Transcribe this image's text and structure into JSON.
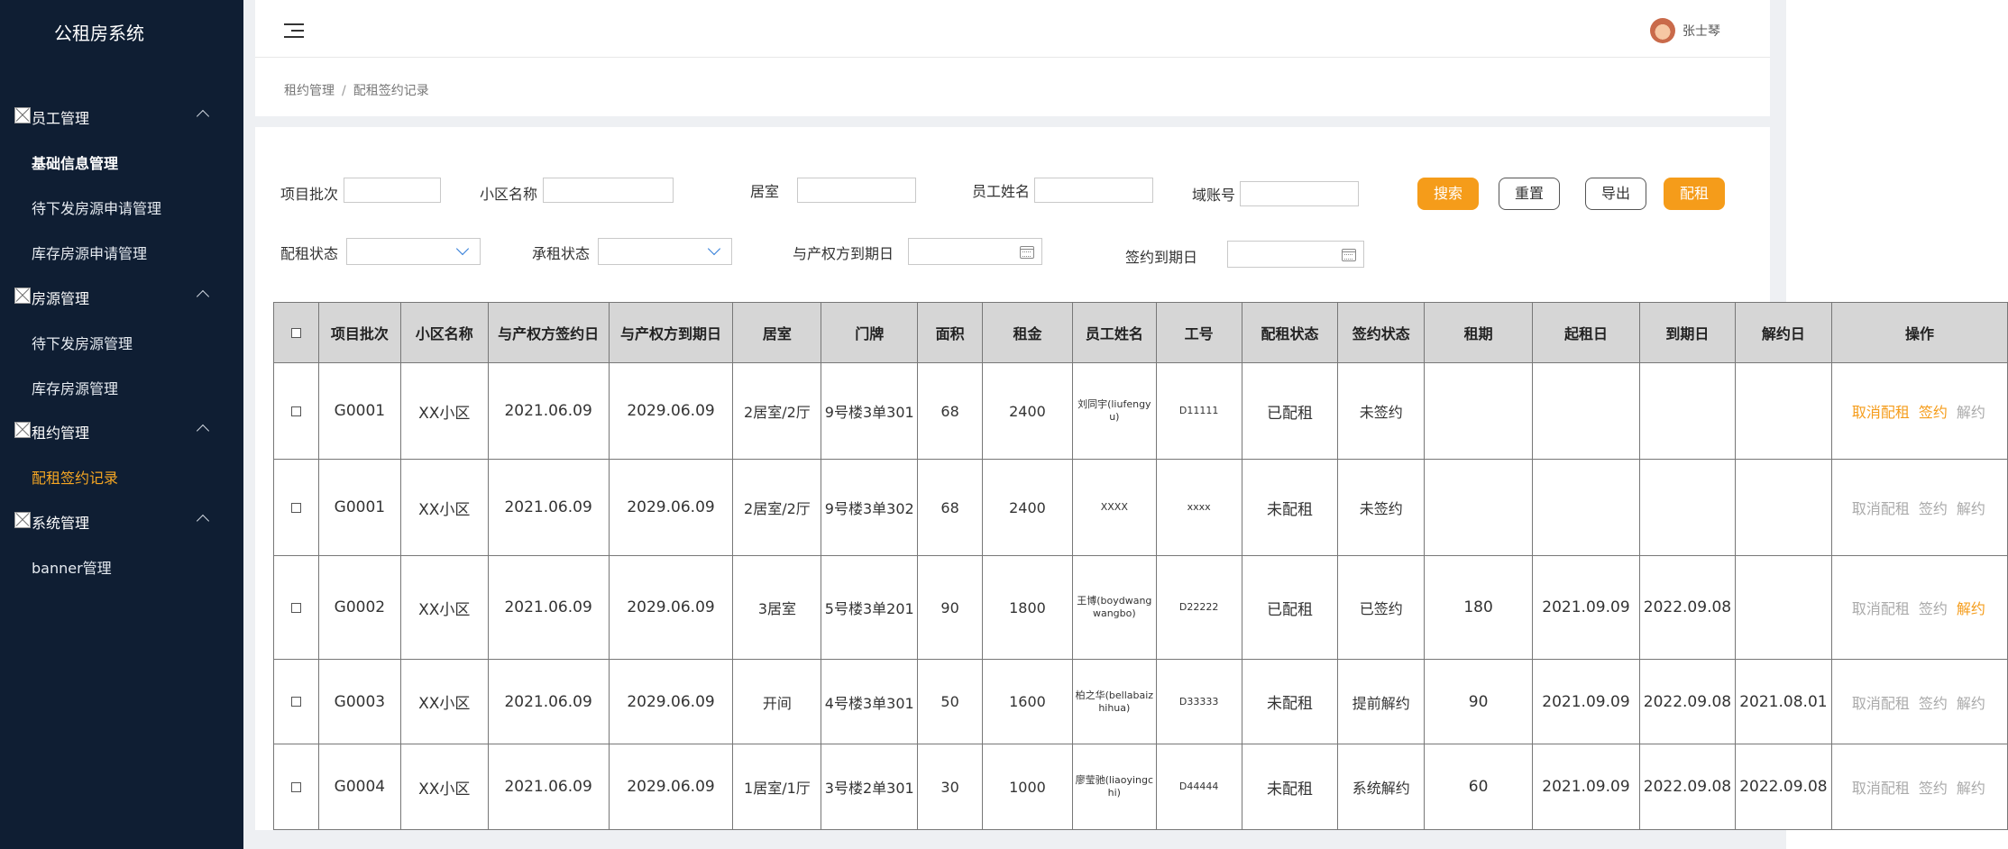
{
  "app": {
    "title": "公租房系统"
  },
  "sidebar": {
    "groups": [
      {
        "label": "员工管理",
        "items": [
          "基础信息管理",
          "待下发房源申请管理",
          "库存房源申请管理"
        ]
      },
      {
        "label": "房源管理",
        "items": [
          "待下发房源管理",
          "库存房源管理"
        ]
      },
      {
        "label": "租约管理",
        "items": [
          "配租签约记录"
        ]
      },
      {
        "label": "系统管理",
        "items": [
          "banner管理"
        ]
      }
    ]
  },
  "header": {
    "user_name": "张士琴"
  },
  "breadcrumb": {
    "parent": "租约管理",
    "sep": "/",
    "current": "配租签约记录"
  },
  "filters": {
    "batch_label": "项目批次",
    "community_label": "小区名称",
    "room_label": "居室",
    "staff_label": "员工姓名",
    "domain_label": "域账号",
    "alloc_status_label": "配租状态",
    "lease_status_label": "承租状态",
    "owner_expiry_label": "与产权方到期日",
    "sign_expiry_label": "签约到期日"
  },
  "buttons": {
    "search": "搜索",
    "reset": "重置",
    "export": "导出",
    "allocate": "配租"
  },
  "table": {
    "headers": [
      "项目批次",
      "小区名称",
      "与产权方签约日",
      "与产权方到期日",
      "居室",
      "门牌",
      "面积",
      "租金",
      "员工姓名",
      "工号",
      "配租状态",
      "签约状态",
      "租期",
      "起租日",
      "到期日",
      "解约日",
      "操作"
    ],
    "rows": [
      {
        "batch": "G0001",
        "community": "XX小区",
        "sign_date": "2021.06.09",
        "expiry_date": "2029.06.09",
        "room": "2居室/2厅",
        "door": "9号楼3单301",
        "area": "68",
        "rent": "2400",
        "staff": "刘同宇(liufengyu)",
        "staff_no": "D11111",
        "alloc_status": "已配租",
        "sign_status": "未签约",
        "term": "",
        "start": "",
        "end": "",
        "terminate": "",
        "ops": [
          "取消配租",
          "签约",
          "解约"
        ]
      },
      {
        "batch": "G0001",
        "community": "XX小区",
        "sign_date": "2021.06.09",
        "expiry_date": "2029.06.09",
        "room": "2居室/2厅",
        "door": "9号楼3单302",
        "area": "68",
        "rent": "2400",
        "staff": "XXXX",
        "staff_no": "xxxx",
        "alloc_status": "未配租",
        "sign_status": "未签约",
        "term": "",
        "start": "",
        "end": "",
        "terminate": "",
        "ops": [
          "取消配租",
          "签约",
          "解约"
        ]
      },
      {
        "batch": "G0002",
        "community": "XX小区",
        "sign_date": "2021.06.09",
        "expiry_date": "2029.06.09",
        "room": "3居室",
        "door": "5号楼3单201",
        "area": "90",
        "rent": "1800",
        "staff": "王博(boydwangwangbo)",
        "staff_no": "D22222",
        "alloc_status": "已配租",
        "sign_status": "已签约",
        "term": "180",
        "start": "2021.09.09",
        "end": "2022.09.08",
        "terminate": "",
        "ops": [
          "取消配租",
          "签约",
          "解约"
        ]
      },
      {
        "batch": "G0003",
        "community": "XX小区",
        "sign_date": "2021.06.09",
        "expiry_date": "2029.06.09",
        "room": "开间",
        "door": "4号楼3单301",
        "area": "50",
        "rent": "1600",
        "staff": "柏之华(bellabaizhihua)",
        "staff_no": "D33333",
        "alloc_status": "未配租",
        "sign_status": "提前解约",
        "term": "90",
        "start": "2021.09.09",
        "end": "2022.09.08",
        "terminate": "2021.08.01",
        "ops": [
          "取消配租",
          "签约",
          "解约"
        ]
      },
      {
        "batch": "G0004",
        "community": "XX小区",
        "sign_date": "2021.06.09",
        "expiry_date": "2029.06.09",
        "room": "1居室/1厅",
        "door": "3号楼2单301",
        "area": "30",
        "rent": "1000",
        "staff": "廖莹驰(liaoyingchi)",
        "staff_no": "D44444",
        "alloc_status": "未配租",
        "sign_status": "系统解约",
        "term": "60",
        "start": "2021.09.09",
        "end": "2022.09.08",
        "terminate": "2022.09.08",
        "ops": [
          "取消配租",
          "签约",
          "解约"
        ]
      }
    ]
  },
  "colors": {
    "sidebar_bg": "#0f1e33",
    "accent": "#f59c1a",
    "active_menu": "#f5a623",
    "header_bg": "#d6d6d6"
  }
}
